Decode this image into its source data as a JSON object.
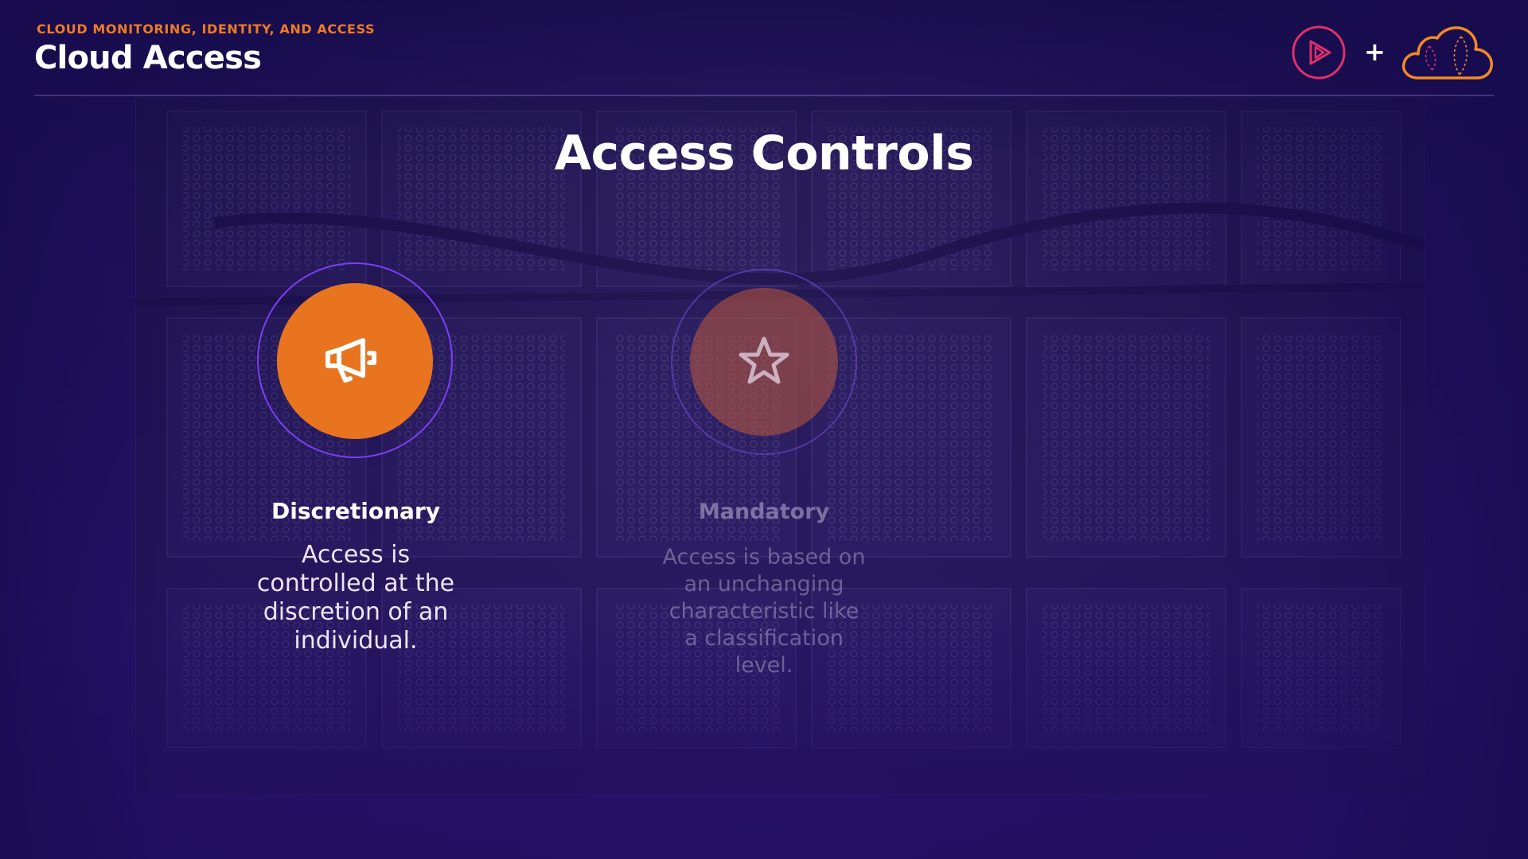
{
  "header": {
    "subtitle": "CLOUD MONITORING, IDENTITY, AND ACCESS",
    "title": "Cloud Access",
    "plus": "+"
  },
  "slide": {
    "title": "Access Controls"
  },
  "cards": [
    {
      "heading": "Discretionary",
      "description": "Access is controlled at the discretion of an individual.",
      "icon": "megaphone-icon",
      "state": "active"
    },
    {
      "heading": "Mandatory",
      "description": "Access is based on an unchanging characteristic like a classification level.",
      "icon": "star-icon",
      "state": "dimmed"
    }
  ],
  "colors": {
    "accent": "#e8741f",
    "subtitle": "#f07b22",
    "ring": "#7b3ff0",
    "background": "#1a0f52",
    "play_logo": "#e0306a",
    "cloud_logo": "#f08a24"
  }
}
